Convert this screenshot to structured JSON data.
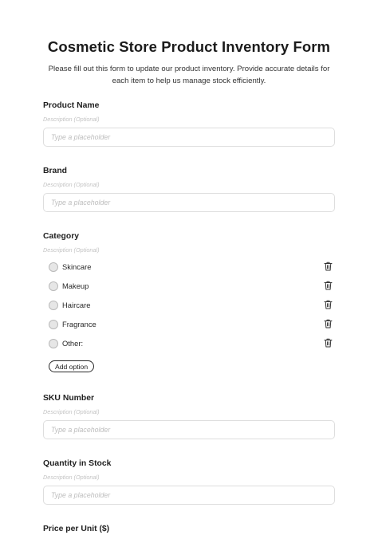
{
  "form": {
    "title": "Cosmetic Store Product Inventory Form",
    "subtitle": "Please fill out this form to update our product inventory. Provide accurate details for each item to help us manage stock efficiently."
  },
  "fields": [
    {
      "label": "Product Name",
      "description": "Description (Optional)",
      "placeholder": "Type a placeholder"
    },
    {
      "label": "Brand",
      "description": "Description (Optional)",
      "placeholder": "Type a placeholder"
    },
    {
      "label": "SKU Number",
      "description": "Description (Optional)",
      "placeholder": "Type a placeholder"
    },
    {
      "label": "Quantity in Stock",
      "description": "Description (Optional)",
      "placeholder": "Type a placeholder"
    },
    {
      "label": "Price per Unit ($)"
    }
  ],
  "category": {
    "label": "Category",
    "description": "Description (Optional)",
    "options": [
      {
        "label": "Skincare",
        "icon": "trash-icon"
      },
      {
        "label": "Makeup",
        "icon": "trash-icon"
      },
      {
        "label": "Haircare",
        "icon": "trash-icon"
      },
      {
        "label": "Fragrance",
        "icon": "trash-icon"
      },
      {
        "label": "Other:",
        "icon": "trash-icon"
      }
    ],
    "add_option_label": "Add option"
  }
}
